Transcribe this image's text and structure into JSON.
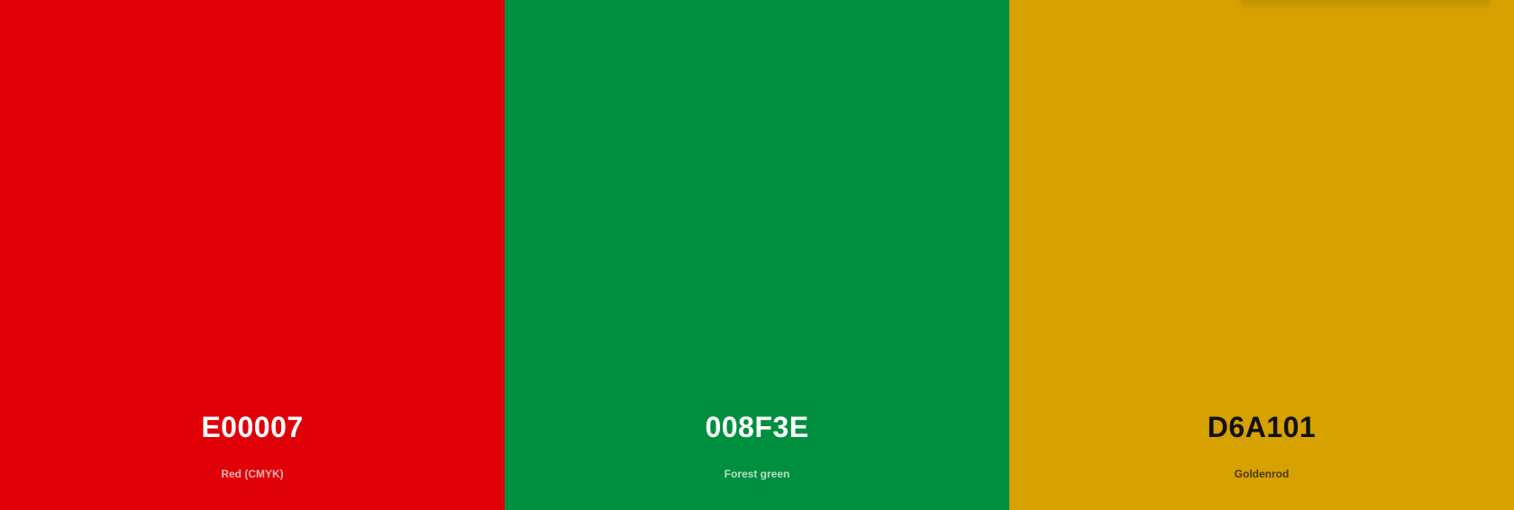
{
  "palette": {
    "swatches": [
      {
        "hex": "E00007",
        "name": "Red (CMYK)",
        "background": "#E00007",
        "hex_text_color": "#ffffff",
        "name_text_color": "#f2b1b3"
      },
      {
        "hex": "008F3E",
        "name": "Forest green",
        "background": "#008F3E",
        "hex_text_color": "#ffffff",
        "name_text_color": "#b2e0c6"
      },
      {
        "hex": "D6A101",
        "name": "Goldenrod",
        "background": "#D6A101",
        "hex_text_color": "#111111",
        "name_text_color": "#4a3a06"
      }
    ]
  }
}
